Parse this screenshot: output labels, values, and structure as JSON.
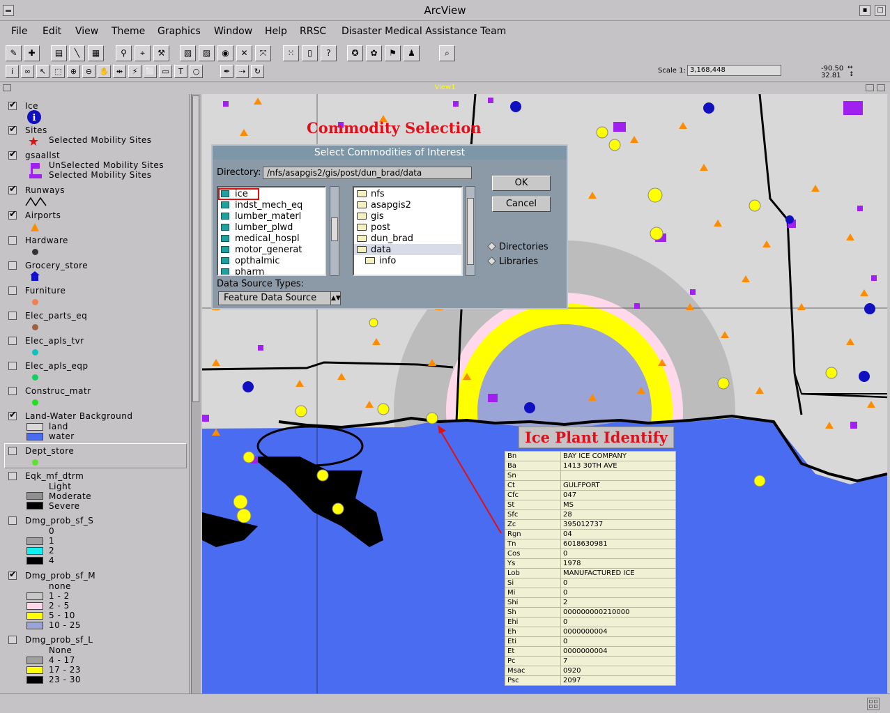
{
  "window": {
    "title": "ArcView"
  },
  "menu": [
    "File",
    "Edit",
    "View",
    "Theme",
    "Graphics",
    "Window",
    "Help",
    "RRSC",
    "Disaster Medical Assistance Team"
  ],
  "toolbar": {
    "scale_label": "Scale 1:",
    "scale_value": "3,168,448",
    "coord_x": "-90.50",
    "coord_y": "32.81"
  },
  "view": {
    "title": "View1"
  },
  "toc": {
    "themes": [
      {
        "name": "Ice",
        "checked": true
      },
      {
        "name": "Sites",
        "checked": true,
        "legend": [
          "Selected Mobility Sites"
        ]
      },
      {
        "name": "gsaallst",
        "checked": true,
        "legend": [
          "UnSelected Mobility Sites",
          "Selected Mobility Sites"
        ]
      },
      {
        "name": "Runways",
        "checked": true
      },
      {
        "name": "Airports",
        "checked": true
      },
      {
        "name": "Hardware",
        "checked": false
      },
      {
        "name": "Grocery_store",
        "checked": false
      },
      {
        "name": "Furniture",
        "checked": false
      },
      {
        "name": "Elec_parts_eq",
        "checked": false
      },
      {
        "name": "Elec_apls_tvr",
        "checked": false
      },
      {
        "name": "Elec_apls_eqp",
        "checked": false
      },
      {
        "name": "Construc_matr",
        "checked": false
      },
      {
        "name": "Land-Water Background",
        "checked": true,
        "legend": [
          "land",
          "water"
        ]
      },
      {
        "name": "Dept_store",
        "checked": false
      },
      {
        "name": "Eqk_mf_dtrm",
        "checked": false,
        "legend": [
          "Light",
          "Moderate",
          "Severe"
        ]
      },
      {
        "name": "Dmg_prob_sf_S",
        "checked": false,
        "legend": [
          "0",
          "1",
          "2",
          "4"
        ]
      },
      {
        "name": "Dmg_prob_sf_M",
        "checked": true,
        "legend": [
          "none",
          "1 - 2",
          "2 - 5",
          "5 - 10",
          "10 - 25"
        ]
      },
      {
        "name": "Dmg_prob_sf_L",
        "checked": false,
        "legend": [
          "None",
          "4 - 17",
          "17 - 23",
          "23 - 30"
        ]
      }
    ]
  },
  "dialog": {
    "title": "Select Commodities of Interest",
    "directory_label": "Directory:",
    "directory_value": "/nfs/asapgis2/gis/post/dun_brad/data",
    "files": [
      "ice",
      "indst_mech_eq",
      "lumber_materl",
      "lumber_plwd",
      "medical_hospl",
      "motor_generat",
      "opthalmic",
      "pharm"
    ],
    "dirs": [
      "nfs",
      "asapgis2",
      "gis",
      "post",
      "dun_brad",
      "data",
      "info"
    ],
    "ok_label": "OK",
    "cancel_label": "Cancel",
    "radio_directories": "Directories",
    "radio_libraries": "Libraries",
    "source_types_label": "Data Source Types:",
    "source_type_value": "Feature Data Source"
  },
  "annotations": {
    "commodity": "Commodity Selection",
    "ice_plant": "Ice Plant Identify"
  },
  "identify": {
    "rows": [
      [
        "Bn",
        "BAY ICE COMPANY"
      ],
      [
        "Ba",
        "1413 30TH AVE"
      ],
      [
        "Sn",
        ""
      ],
      [
        "Ct",
        "GULFPORT"
      ],
      [
        "Cfc",
        "047"
      ],
      [
        "St",
        "MS"
      ],
      [
        "Sfc",
        "28"
      ],
      [
        "Zc",
        "395012737"
      ],
      [
        "Rgn",
        "04"
      ],
      [
        "Tn",
        "6018630981"
      ],
      [
        "Cos",
        "0"
      ],
      [
        "Ys",
        "1978"
      ],
      [
        "Lob",
        "MANUFACTURED ICE"
      ],
      [
        "Si",
        "0"
      ],
      [
        "Mi",
        "0"
      ],
      [
        "Shi",
        "2"
      ],
      [
        "Sh",
        "000000000210000"
      ],
      [
        "Ehi",
        "0"
      ],
      [
        "Eh",
        "0000000004"
      ],
      [
        "Eti",
        "0"
      ],
      [
        "Et",
        "0000000004"
      ],
      [
        "Pc",
        "7"
      ],
      [
        "Msac",
        "0920"
      ],
      [
        "Psc",
        "2097"
      ]
    ]
  },
  "colors": {
    "water": "#4a6cf0",
    "land": "#d8d8d8",
    "zone_gray": "#b8b8b8",
    "zone_pink": "#ffd8ec",
    "zone_yellow": "#ffff00",
    "zone_blue": "#9aa4d6",
    "accent_red": "#e0101a",
    "airport_orange": "#ff8c00",
    "site_purple": "#a020f0"
  }
}
